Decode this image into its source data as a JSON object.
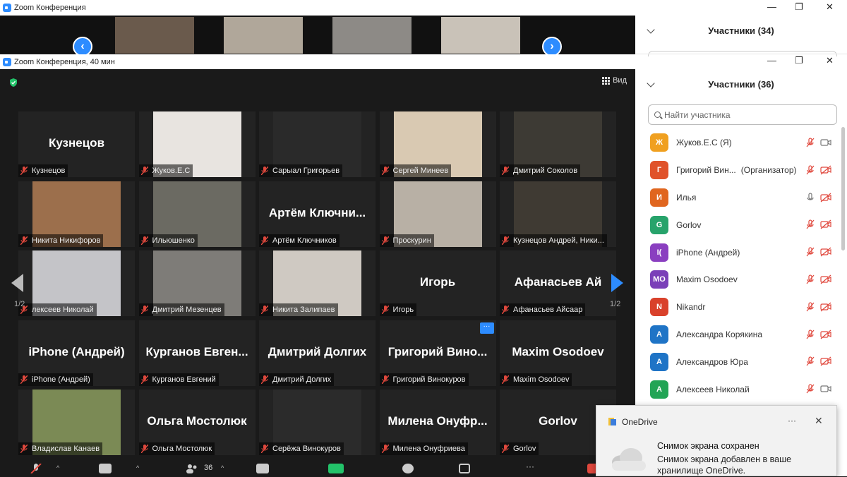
{
  "back_window": {
    "title": "Zoom Конференция",
    "prev_label": "‹",
    "next_label": "›",
    "participants_title": "Участники (34)",
    "min": "—",
    "restore": "❐",
    "close": "✕"
  },
  "front_window": {
    "title": "Zoom Конференция, 40 мин",
    "view_label": "Вид",
    "page_left": "1/2",
    "page_right": "1/2",
    "participants_title": "Участники (36)",
    "min": "—",
    "restore": "❐",
    "close": "✕",
    "search_placeholder": "Найти участника",
    "participants_count": "36"
  },
  "tiles": [
    {
      "name": "Кузнецов",
      "big": "Кузнецов",
      "video": false
    },
    {
      "name": "Жуков.Е.С",
      "big": "",
      "video": true,
      "bg": "#e8e4e0"
    },
    {
      "name": "Сарыал Григорьев",
      "big": "",
      "video": true,
      "bg": "#2a2a2a"
    },
    {
      "name": "Сергей Минеев",
      "big": "",
      "video": true,
      "bg": "#d9c9b2"
    },
    {
      "name": "Дмитрий Соколов",
      "big": "",
      "video": true,
      "bg": "#3d3a34"
    },
    {
      "name": "Никита Никифоров",
      "big": "",
      "video": true,
      "bg": "#9c6f4c"
    },
    {
      "name": "Ильюшенко",
      "big": "",
      "video": true,
      "bg": "#6b6a62"
    },
    {
      "name": "Артём Ключников",
      "big": "Артём Ключни...",
      "video": false
    },
    {
      "name": "Проскурин",
      "big": "",
      "video": true,
      "bg": "#b8b0a5"
    },
    {
      "name": "Кузнецов Андрей, Ники...",
      "big": "",
      "video": true,
      "bg": "#3f3a33"
    },
    {
      "name": "лексеев Николай",
      "big": "",
      "video": true,
      "bg": "#c4c4c8"
    },
    {
      "name": "Дмитрий Мезенцев",
      "big": "",
      "video": true,
      "bg": "#7e7c78"
    },
    {
      "name": "Никита Залипаев",
      "big": "",
      "video": true,
      "bg": "#cfc9c2"
    },
    {
      "name": "Игорь",
      "big": "Игорь",
      "video": false
    },
    {
      "name": "Афанасьев Айсаар",
      "big": "Афанасьев Ай",
      "video": false
    },
    {
      "name": "iPhone (Андрей)",
      "big": "iPhone (Андрей)",
      "video": false
    },
    {
      "name": "Курганов Евгений",
      "big": "Курганов Евген...",
      "video": false
    },
    {
      "name": "Дмитрий Долгих",
      "big": "Дмитрий Долгих",
      "video": false
    },
    {
      "name": "Григорий Винокуров",
      "big": "Григорий Вино...",
      "video": false,
      "options": "···"
    },
    {
      "name": "Maxim Osodoev",
      "big": "Maxim Osodoev",
      "video": false
    },
    {
      "name": "Владислав Канаев",
      "big": "",
      "video": true,
      "bg": "#7b8a55"
    },
    {
      "name": "Ольга Мостолюк",
      "big": "Ольга Мостолюк",
      "video": false
    },
    {
      "name": "Серёжа Винокуров",
      "big": "",
      "video": true,
      "bg": "#2b2b2b"
    },
    {
      "name": "Милена Онуфриева",
      "big": "Милена Онуфр...",
      "video": false
    },
    {
      "name": "Gorlov",
      "big": "Gorlov",
      "video": false
    }
  ],
  "participants": [
    {
      "initials": "Ж",
      "color": "#f0a020",
      "name": "Жуков.Е.С (Я)",
      "note": "",
      "mic": "off",
      "cam": "on"
    },
    {
      "initials": "Г",
      "color": "#e0522a",
      "name": "Григорий Вин...",
      "note": "(Организатор)",
      "mic": "off",
      "cam": "off"
    },
    {
      "initials": "И",
      "color": "#e0661f",
      "name": "Илья",
      "note": "",
      "mic": "on",
      "cam": "off"
    },
    {
      "initials": "G",
      "color": "#27a36b",
      "name": "Gorlov",
      "note": "",
      "mic": "off",
      "cam": "off"
    },
    {
      "initials": "I(",
      "color": "#8a3fc0",
      "name": "iPhone (Андрей)",
      "note": "",
      "mic": "off",
      "cam": "off"
    },
    {
      "initials": "MO",
      "color": "#7a3fb8",
      "name": "Maxim Osodoev",
      "note": "",
      "mic": "off",
      "cam": "off"
    },
    {
      "initials": "N",
      "color": "#d9412b",
      "name": "Nikandr",
      "note": "",
      "mic": "off",
      "cam": "off"
    },
    {
      "initials": "A",
      "color": "#1f74c6",
      "name": "Александра Корякина",
      "note": "",
      "mic": "off",
      "cam": "off"
    },
    {
      "initials": "A",
      "color": "#1f74c6",
      "name": "Александров Юра",
      "note": "",
      "mic": "off",
      "cam": "off"
    },
    {
      "initials": "A",
      "color": "#22a455",
      "name": "Алексеев Николай",
      "note": "",
      "mic": "off",
      "cam": "on"
    }
  ],
  "toast": {
    "app": "OneDrive",
    "more": "···",
    "close": "✕",
    "heading": "Снимок экрана сохранен",
    "body": "Снимок экрана добавлен в ваше хранилище OneDrive."
  },
  "colors": {
    "accent": "#2d8cff",
    "mute": "#e0483d"
  }
}
